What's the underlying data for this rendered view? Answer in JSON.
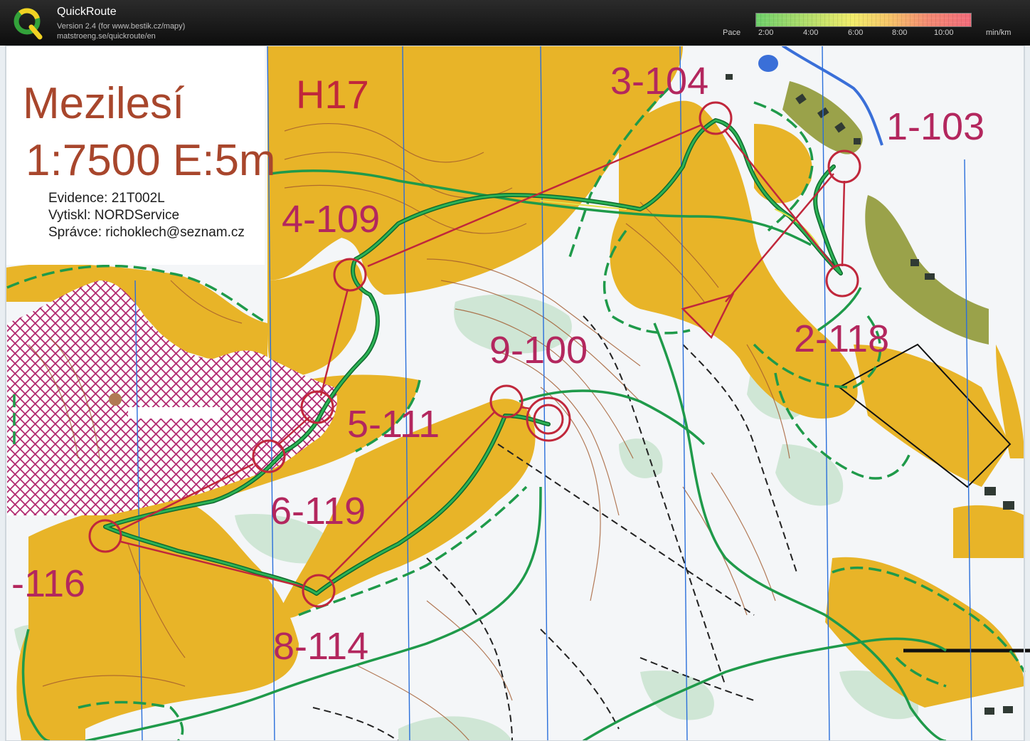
{
  "app": {
    "title": "QuickRoute",
    "version_line": "Version 2.4  (for www.bestik.cz/mapy)",
    "url_line": "matstroeng.se/quickroute/en"
  },
  "pace_legend": {
    "label": "Pace",
    "ticks": [
      "2:00",
      "4:00",
      "6:00",
      "8:00",
      "10:00"
    ],
    "unit": "min/km",
    "colors": [
      "#6dcf6a",
      "#f2ec6a",
      "#f26b7a"
    ]
  },
  "map": {
    "title": "Mezilesí",
    "scale_line": "1:7500 E:5m",
    "info_lines": [
      "Evidence: 21T002L",
      "Vytiskl: NORDService",
      "Správce: richoklech@seznam.cz"
    ],
    "class_name": "H17",
    "controls": [
      {
        "label": "1-103"
      },
      {
        "label": "2-118"
      },
      {
        "label": "3-104"
      },
      {
        "label": "4-109"
      },
      {
        "label": "5-111"
      },
      {
        "label": "6-119"
      },
      {
        "label": "-116"
      },
      {
        "label": "8-114"
      },
      {
        "label": "9-100"
      }
    ],
    "colors": {
      "course": "#c0273b",
      "route": "#1f9a4a",
      "open_land": "#e8b428",
      "forbidden": "#b0246c",
      "paper": "#f4f6f8"
    }
  }
}
